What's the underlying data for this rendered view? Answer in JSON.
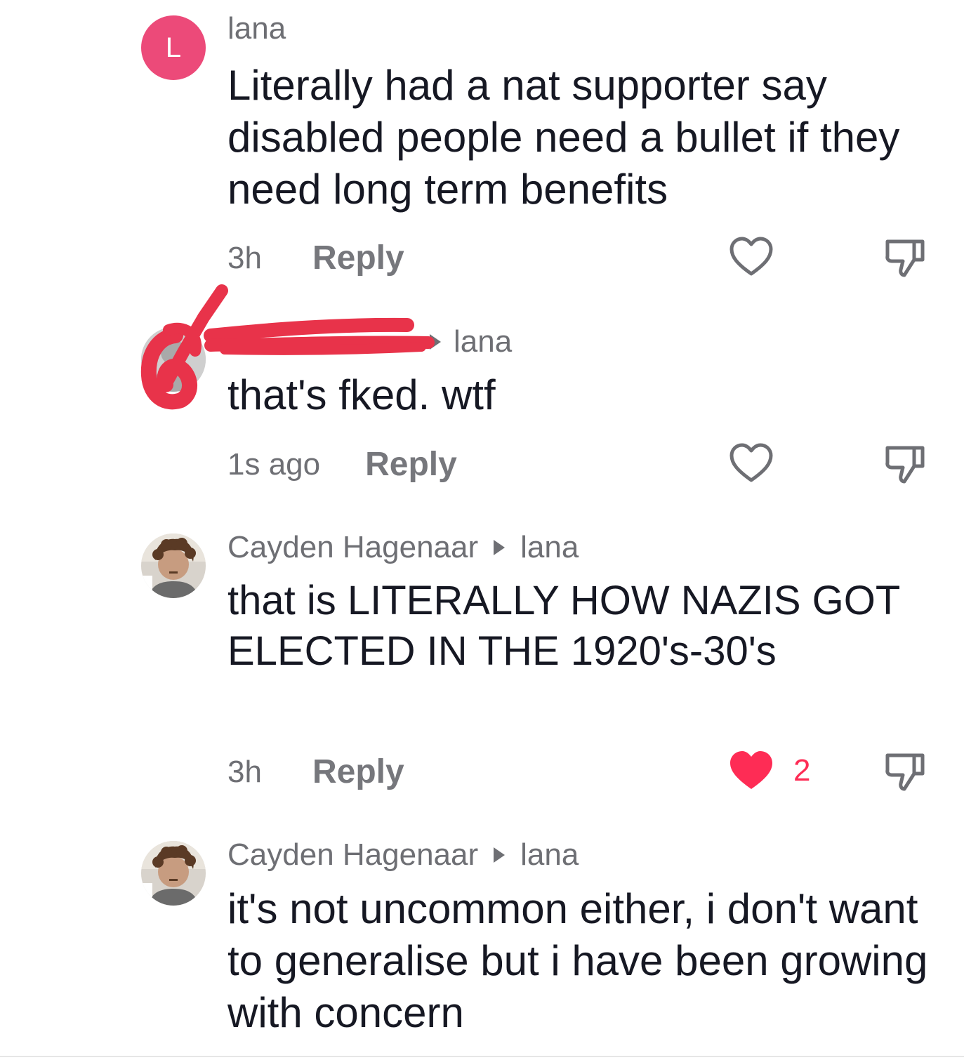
{
  "comments": [
    {
      "avatar_letter": "L",
      "author": "lana",
      "reply_to": "",
      "text": "Literally had a nat supporter say disabled people need a bullet if they need long term benefits",
      "time": "3h",
      "reply_label": "Reply",
      "liked": false,
      "like_count": ""
    },
    {
      "author": "",
      "reply_to": "lana",
      "text": "that's fked. wtf",
      "time": "1s ago",
      "reply_label": "Reply",
      "liked": false,
      "like_count": ""
    },
    {
      "author": "Cayden Hagenaar",
      "reply_to": "lana",
      "text": "that is LITERALLY HOW NAZIS GOT ELECTED IN THE 1920's-30's",
      "time": "3h",
      "reply_label": "Reply",
      "liked": true,
      "like_count": "2"
    },
    {
      "author": "Cayden Hagenaar",
      "reply_to": "lana",
      "text": "it's not uncommon either, i don't want to generalise but i have been growing with concern"
    }
  ],
  "icons": {
    "like": "heart-icon",
    "dislike": "thumbs-down-icon",
    "reply_arrow": "reply-arrow-icon"
  },
  "colors": {
    "like_active": "#fe2c55",
    "avatar_letter_bg": "#ec4a79",
    "redaction": "#e8334a",
    "secondary_text": "#6e6f74"
  }
}
